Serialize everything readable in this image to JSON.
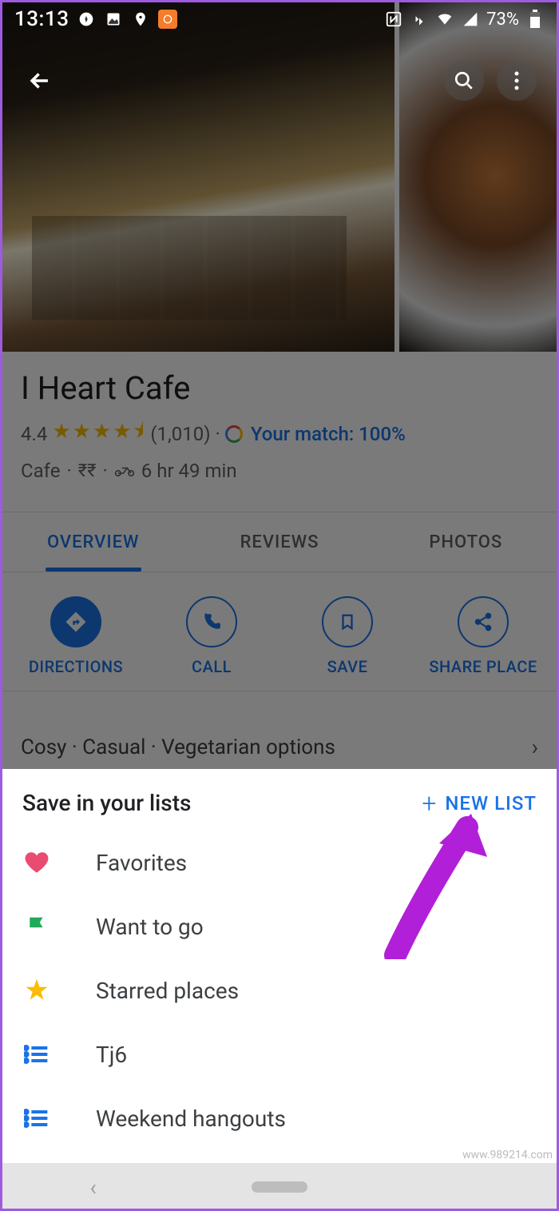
{
  "statusbar": {
    "time": "13:13",
    "battery": "73%"
  },
  "place": {
    "title": "I Heart Cafe",
    "rating": "4.4",
    "reviews": "(1,010)",
    "match_label": "Your match: 100%",
    "category": "Cafe",
    "price": "₹₹",
    "distance": "6 hr 49 min"
  },
  "tabs": {
    "overview": "OVERVIEW",
    "reviews": "REVIEWS",
    "photos": "PHOTOS"
  },
  "actions": {
    "directions": "DIRECTIONS",
    "call": "CALL",
    "save": "SAVE",
    "share": "SHARE PLACE"
  },
  "attributes_row": "Cosy · Casual · Vegetarian options",
  "sheet": {
    "title": "Save in your lists",
    "new_list": "NEW LIST",
    "items": [
      {
        "label": "Favorites"
      },
      {
        "label": "Want to go"
      },
      {
        "label": "Starred places"
      },
      {
        "label": "Tj6"
      },
      {
        "label": "Weekend hangouts"
      }
    ]
  },
  "watermark": "www.989214.com"
}
